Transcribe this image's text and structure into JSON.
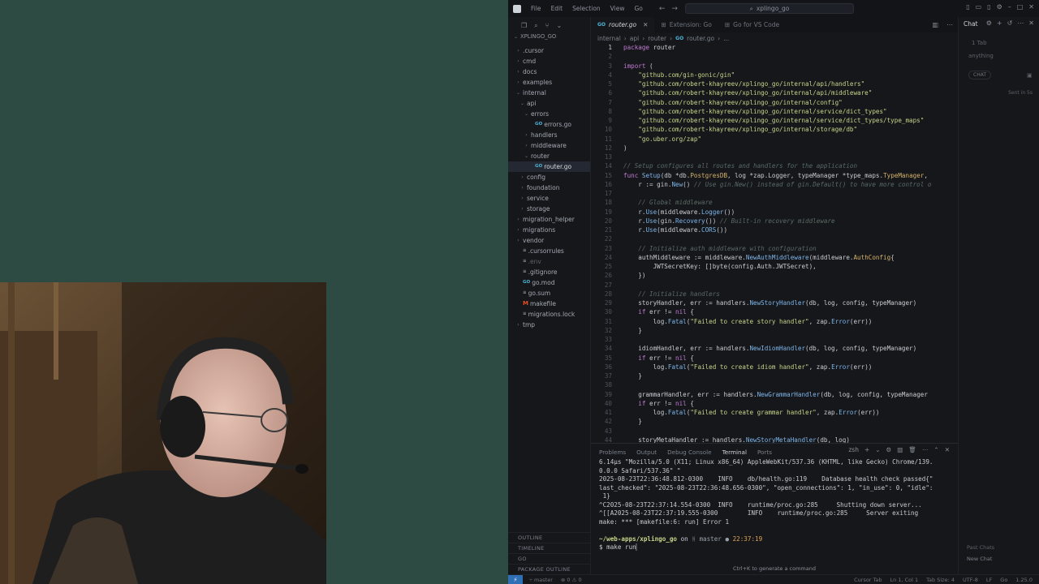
{
  "menu": [
    "File",
    "Edit",
    "Selection",
    "View",
    "Go"
  ],
  "command_center": "xplingo_go",
  "tabs": [
    {
      "label": "router.go",
      "active": true
    },
    {
      "label": "Extension: Go",
      "active": false
    },
    {
      "label": "Go for VS Code",
      "active": false
    }
  ],
  "breadcrumbs": [
    "internal",
    "api",
    "router",
    "router.go",
    "..."
  ],
  "explorer": {
    "root": "XPLINGO_GO",
    "items": [
      {
        "label": ".cursor",
        "depth": 1,
        "type": "folder"
      },
      {
        "label": "cmd",
        "depth": 1,
        "type": "folder"
      },
      {
        "label": "docs",
        "depth": 1,
        "type": "folder"
      },
      {
        "label": "examples",
        "depth": 1,
        "type": "folder"
      },
      {
        "label": "internal",
        "depth": 1,
        "type": "folder-open"
      },
      {
        "label": "api",
        "depth": 2,
        "type": "folder-open"
      },
      {
        "label": "errors",
        "depth": 3,
        "type": "folder-open"
      },
      {
        "label": "errors.go",
        "depth": 4,
        "type": "go"
      },
      {
        "label": "handlers",
        "depth": 3,
        "type": "folder"
      },
      {
        "label": "middleware",
        "depth": 3,
        "type": "folder"
      },
      {
        "label": "router",
        "depth": 3,
        "type": "folder-open"
      },
      {
        "label": "router.go",
        "depth": 4,
        "type": "go",
        "active": true
      },
      {
        "label": "config",
        "depth": 2,
        "type": "folder"
      },
      {
        "label": "foundation",
        "depth": 2,
        "type": "folder"
      },
      {
        "label": "service",
        "depth": 2,
        "type": "folder"
      },
      {
        "label": "storage",
        "depth": 2,
        "type": "folder"
      },
      {
        "label": "migration_helper",
        "depth": 1,
        "type": "folder"
      },
      {
        "label": "migrations",
        "depth": 1,
        "type": "folder"
      },
      {
        "label": "vendor",
        "depth": 1,
        "type": "folder"
      },
      {
        "label": ".cursorrules",
        "depth": 1,
        "type": "file"
      },
      {
        "label": ".env",
        "depth": 1,
        "type": "file",
        "dim": true
      },
      {
        "label": ".gitignore",
        "depth": 1,
        "type": "file"
      },
      {
        "label": "go.mod",
        "depth": 1,
        "type": "go"
      },
      {
        "label": "go.sum",
        "depth": 1,
        "type": "file"
      },
      {
        "label": "makefile",
        "depth": 1,
        "type": "make"
      },
      {
        "label": "migrations.lock",
        "depth": 1,
        "type": "file"
      },
      {
        "label": "tmp",
        "depth": 1,
        "type": "folder"
      }
    ],
    "bottom": [
      "OUTLINE",
      "TIMELINE",
      "GO",
      "PACKAGE OUTLINE"
    ]
  },
  "code_lines": [
    "package router",
    "",
    "import (",
    "    \"github.com/gin-gonic/gin\"",
    "    \"github.com/robert-khayreev/xplingo_go/internal/api/handlers\"",
    "    \"github.com/robert-khayreev/xplingo_go/internal/api/middleware\"",
    "    \"github.com/robert-khayreev/xplingo_go/internal/config\"",
    "    \"github.com/robert-khayreev/xplingo_go/internal/service/dict_types\"",
    "    \"github.com/robert-khayreev/xplingo_go/internal/service/dict_types/type_maps\"",
    "    \"github.com/robert-khayreev/xplingo_go/internal/storage/db\"",
    "    \"go.uber.org/zap\"",
    ")",
    "",
    "// Setup configures all routes and handlers for the application",
    "func Setup(db *db.PostgresDB, log *zap.Logger, typeManager *type_maps.TypeManager,",
    "    r := gin.New() // Use gin.New() instead of gin.Default() to have more control o",
    "",
    "    // Global middleware",
    "    r.Use(middleware.Logger())",
    "    r.Use(gin.Recovery()) // Built-in recovery middleware",
    "    r.Use(middleware.CORS())",
    "",
    "    // Initialize auth middleware with configuration",
    "    authMiddleware := middleware.NewAuthMiddleware(middleware.AuthConfig{",
    "        JWTSecretKey: []byte(config.Auth.JWTSecret),",
    "    })",
    "",
    "    // Initialize handlers",
    "    storyHandler, err := handlers.NewStoryHandler(db, log, config, typeManager)",
    "    if err != nil {",
    "        log.Fatal(\"Failed to create story handler\", zap.Error(err))",
    "    }",
    "",
    "    idiomHandler, err := handlers.NewIdiomHandler(db, log, config, typeManager)",
    "    if err != nil {",
    "        log.Fatal(\"Failed to create idiom handler\", zap.Error(err))",
    "    }",
    "",
    "    grammarHandler, err := handlers.NewGrammarHandler(db, log, config, typeManager",
    "    if err != nil {",
    "        log.Fatal(\"Failed to create grammar handler\", zap.Error(err))",
    "    }",
    "",
    "    storyMetaHandler := handlers.NewStoryMetaHandler(db, log)"
  ],
  "panel_tabs": [
    "Problems",
    "Output",
    "Debug Console",
    "Terminal",
    "Ports"
  ],
  "panel_active": "Terminal",
  "terminal_shell": "zsh",
  "terminal_lines": [
    "6.14µs \"Mozilla/5.0 (X11; Linux x86_64) AppleWebKit/537.36 (KHTML, like Gecko) Chrome/139.",
    "0.0.0 Safari/537.36\" \"",
    "2025-08-23T22:36:48.812-0300    INFO    db/health.go:119    Database health check passed{\"",
    "last_checked\": \"2025-08-23T22:36:48.656-0300\", \"open_connections\": 1, \"in_use\": 0, \"idle\":",
    " 1}",
    "^C2025-08-23T22:37:14.554-0300  INFO    runtime/proc.go:285     Shutting down server...",
    "^[[A2025-08-23T22:37:19.555-0300        INFO    runtime/proc.go:285     Server exiting",
    "make: *** [makefile:6: run] Error 1",
    ""
  ],
  "prompt": {
    "path": "~/web-apps/xplingo_go",
    "on": " on ",
    "branch": "ᚻ master",
    "time": "22:37:19",
    "command": "$ make run"
  },
  "cmdk_hint": "Ctrl+K to generate a command",
  "chat": {
    "title": "Chat",
    "tabs_label": "1 Tab",
    "placeholder": "anything",
    "pill": "CHAT",
    "search": "Sent in 5s",
    "past": "Past Chats",
    "new_chat": "New Chat"
  },
  "status": {
    "branch": "master",
    "problems": "⊗ 0 ⚠ 0",
    "right": [
      "Cursor Tab",
      "Ln 1, Col 1",
      "Tab Size: 4",
      "UTF-8",
      "LF",
      "Go",
      "1.25.0"
    ]
  }
}
